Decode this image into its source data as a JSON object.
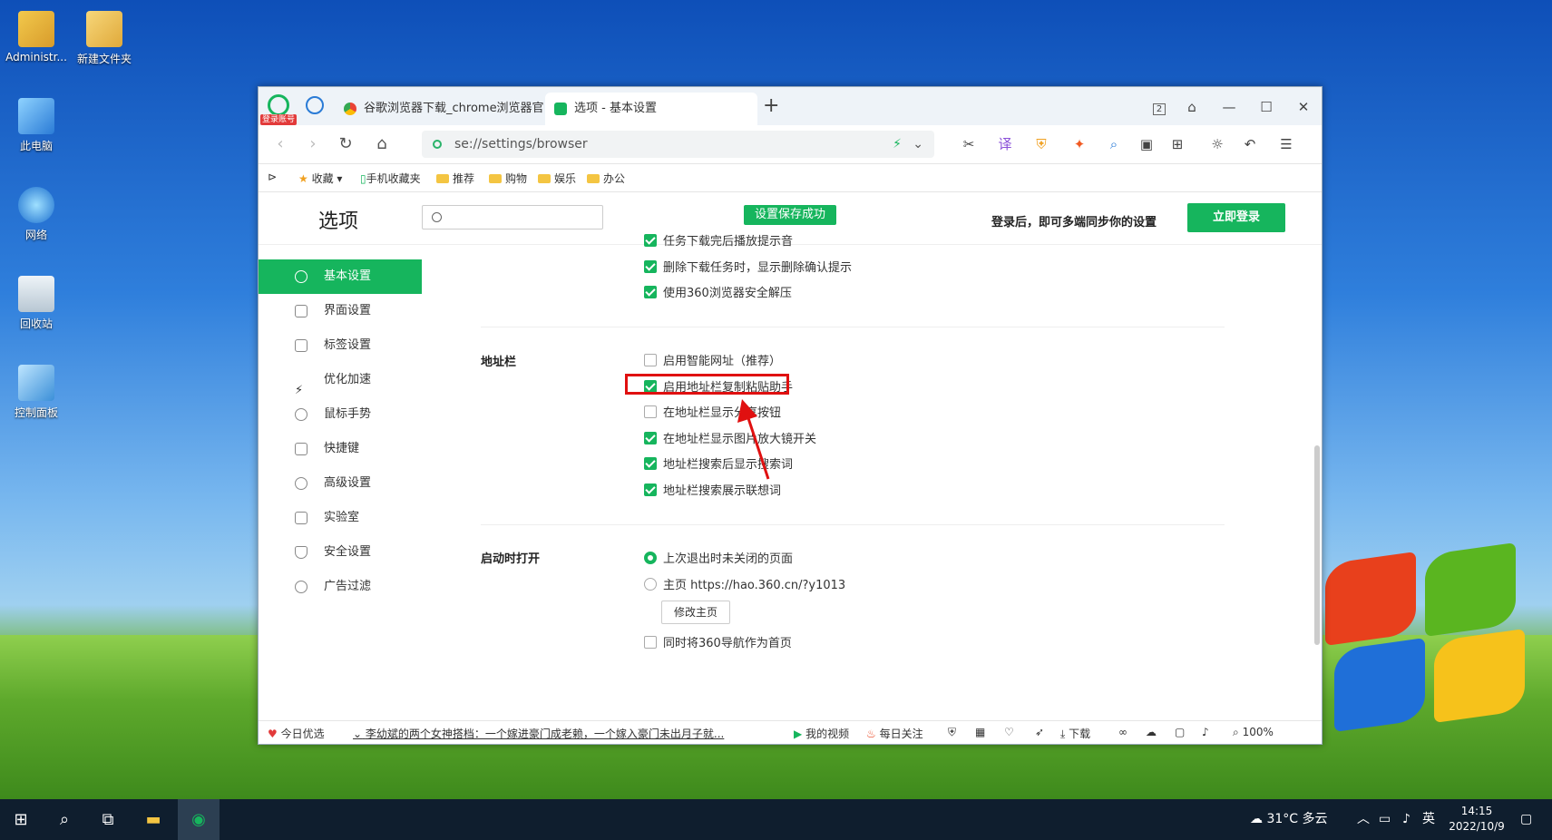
{
  "desktop": {
    "icons": [
      {
        "label": "Administr..."
      },
      {
        "label": "新建文件夹"
      },
      {
        "label": "此电脑"
      },
      {
        "label": "网络"
      },
      {
        "label": "回收站"
      },
      {
        "label": "控制面板"
      }
    ]
  },
  "browser": {
    "login_badge": "登录账号",
    "tabs": [
      {
        "label": "谷歌浏览器下载_chrome浏览器官"
      },
      {
        "label": "选项 - 基本设置"
      }
    ],
    "tab_count": "2",
    "address": "se://settings/browser",
    "bookmarks": [
      "收藏",
      "手机收藏夹",
      "推荐",
      "购物",
      "娱乐",
      "办公"
    ]
  },
  "settings": {
    "title": "选项",
    "search_placeholder": "",
    "toast": "设置保存成功",
    "sync_message": "登录后，即可多端同步你的设置",
    "login_button": "立即登录",
    "sidebar": [
      {
        "label": "基本设置",
        "active": true
      },
      {
        "label": "界面设置"
      },
      {
        "label": "标签设置"
      },
      {
        "label": "优化加速"
      },
      {
        "label": "鼠标手势"
      },
      {
        "label": "快捷键"
      },
      {
        "label": "高级设置"
      },
      {
        "label": "实验室"
      },
      {
        "label": "安全设置"
      },
      {
        "label": "广告过滤"
      }
    ],
    "download_options": [
      {
        "label": "任务下载完后播放提示音",
        "checked": true
      },
      {
        "label": "删除下载任务时，显示删除确认提示",
        "checked": true
      },
      {
        "label": "使用360浏览器安全解压",
        "checked": true
      }
    ],
    "address_bar": {
      "label": "地址栏",
      "options": [
        {
          "label": "启用智能网址（推荐）",
          "checked": false
        },
        {
          "label": "启用地址栏复制粘贴助手",
          "checked": true
        },
        {
          "label": "在地址栏显示分享按钮",
          "checked": false
        },
        {
          "label": "在地址栏显示图片放大镜开关",
          "checked": true
        },
        {
          "label": "地址栏搜索后显示搜索词",
          "checked": true
        },
        {
          "label": "地址栏搜索展示联想词",
          "checked": true
        }
      ]
    },
    "startup": {
      "label": "启动时打开",
      "option_last": "上次退出时未关闭的页面",
      "option_home": "主页  https://hao.360.cn/?y1013",
      "modify_button": "修改主页",
      "nav_home": "同时将360导航作为首页"
    }
  },
  "statusbar": {
    "today": "今日优选",
    "news": "李幼斌的两个女神搭档：一个嫁进豪门成老赖，一个嫁入豪门未出月子就...",
    "video": "我的视频",
    "daily": "每日关注",
    "download": "下载",
    "zoom": "100%"
  },
  "taskbar": {
    "weather": "31°C 多云",
    "ime": "英",
    "time": "14:15",
    "date": "2022/10/9"
  },
  "colors": {
    "accent": "#16b55d",
    "highlight": "#e01010"
  }
}
